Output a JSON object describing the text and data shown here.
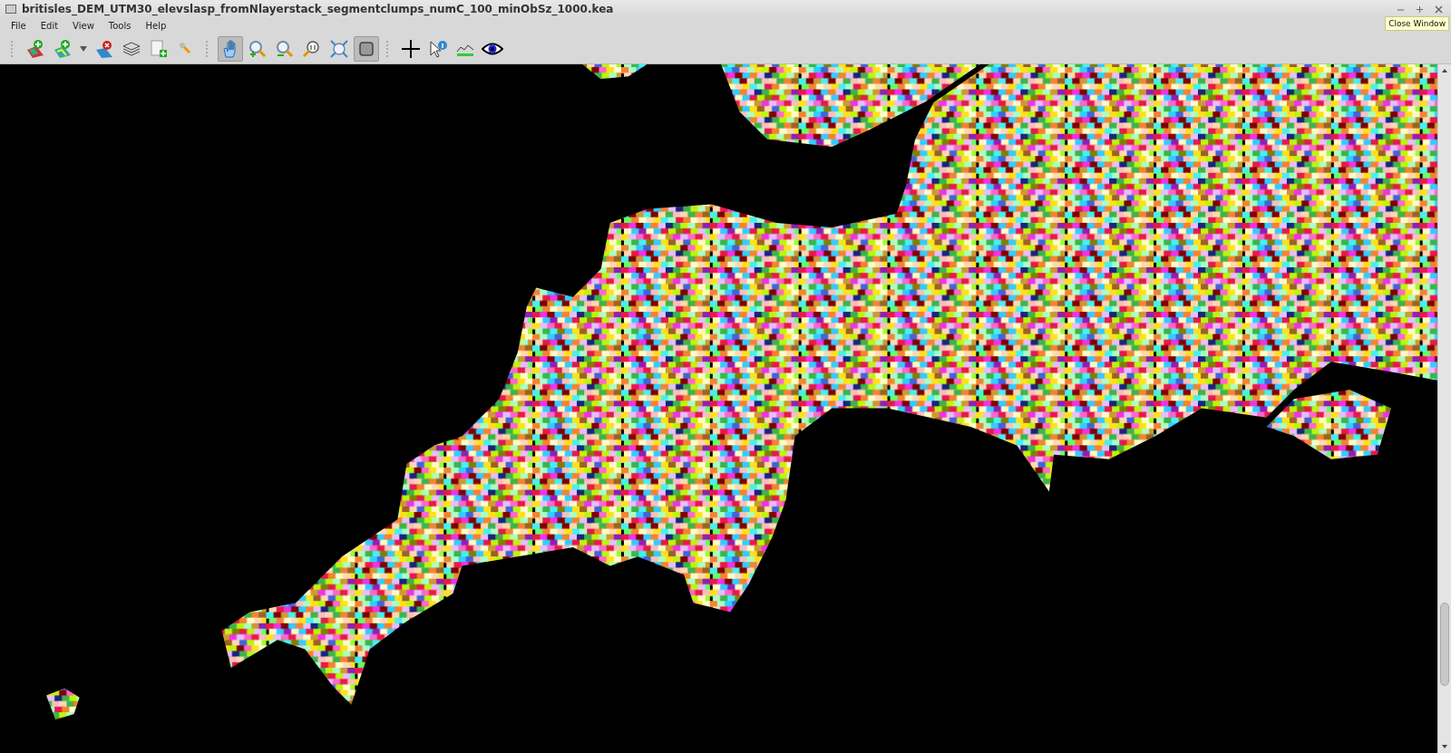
{
  "window": {
    "title": "britisles_DEM_UTM30_elevslasp_fromNlayerstack_segmentclumps_numC_100_minObSz_1000.kea"
  },
  "tooltip": "Close Window",
  "menu": [
    "File",
    "Edit",
    "View",
    "Tools",
    "Help"
  ],
  "toolbar_groups": [
    [
      {
        "selected": false
      },
      {
        "selected": false
      },
      {
        "selected": false
      },
      {
        "selected": false
      },
      {
        "selected": false
      },
      {
        "selected": false
      },
      {
        "selected": false
      }
    ],
    [
      {
        "selected": true
      },
      {
        "selected": false
      },
      {
        "selected": false
      },
      {
        "selected": false
      },
      {
        "selected": false
      },
      {
        "selected": true
      }
    ],
    [
      {
        "selected": false
      },
      {
        "selected": false
      },
      {
        "selected": false
      },
      {
        "selected": false
      }
    ]
  ]
}
